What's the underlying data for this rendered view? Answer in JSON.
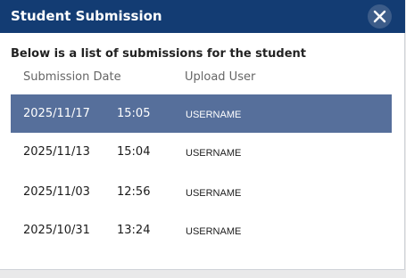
{
  "dialog": {
    "title": "Student Submission",
    "close_icon": "close-x-icon",
    "intro": "Below is a list of submissions for the student",
    "columns": {
      "date": "Submission Date",
      "user": "Upload User"
    },
    "rows": [
      {
        "date": "2025/11/17",
        "time": "15:05",
        "user": "USERNAME",
        "selected": true
      },
      {
        "date": "2025/11/13",
        "time": "15:04",
        "user": "USERNAME",
        "selected": false
      },
      {
        "date": "2025/11/03",
        "time": "12:56",
        "user": "USERNAME",
        "selected": false
      },
      {
        "date": "2025/10/31",
        "time": "13:24",
        "user": "USERNAME",
        "selected": false
      }
    ]
  },
  "colors": {
    "title_bar": "#133c73",
    "close_button": "#3c5c89",
    "selected_row": "#566f9b"
  }
}
